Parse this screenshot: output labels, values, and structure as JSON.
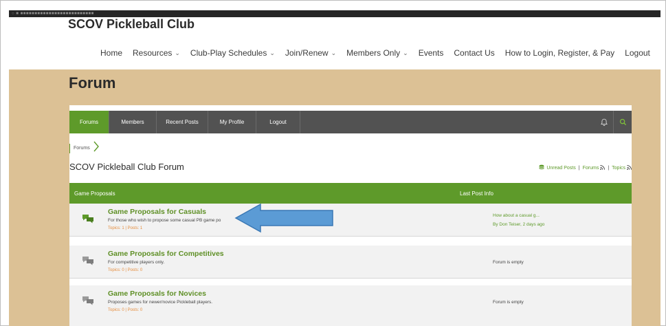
{
  "site": {
    "title": "SCOV Pickleball Club"
  },
  "nav": [
    {
      "label": "Home",
      "caret": false
    },
    {
      "label": "Resources",
      "caret": true
    },
    {
      "label": "Club-Play Schedules",
      "caret": true
    },
    {
      "label": "Join/Renew",
      "caret": true
    },
    {
      "label": "Members Only",
      "caret": true
    },
    {
      "label": "Events",
      "caret": false
    },
    {
      "label": "Contact Us",
      "caret": false
    },
    {
      "label": "How to Login, Register, & Pay",
      "caret": false
    },
    {
      "label": "Logout",
      "caret": false
    }
  ],
  "page": {
    "title": "Forum"
  },
  "forum_nav": {
    "tabs": [
      "Forums",
      "Members",
      "Recent Posts",
      "My Profile",
      "Logout"
    ],
    "active": "Forums"
  },
  "breadcrumb": {
    "label": "Forums"
  },
  "forum": {
    "title": "SCOV Pickleball Club Forum",
    "unread_label": "Unread Posts",
    "forums_label": "Forums",
    "topics_label": "Topics"
  },
  "category": {
    "name": "Game Proposals",
    "last_post_header": "Last Post Info"
  },
  "forums": [
    {
      "name": "Game Proposals for Casuals",
      "description": "For those who wish to propose some casual PB game po",
      "stats": "Topics: 1  |  Posts: 1",
      "last_title": "How about a casual g...",
      "last_by": "By Don Teiser, 2 days ago",
      "unread": true
    },
    {
      "name": "Game Proposals for Competitives",
      "description": "For competitive players only.",
      "stats": "Topics: 0  |  Posts: 0",
      "last_title": "Forum is empty",
      "last_by": "",
      "unread": false
    },
    {
      "name": "Game Proposals for Novices",
      "description": "Proposes games for newer/novice Pickleball players.",
      "stats": "Topics: 0  |  Posts: 0",
      "last_title": "Forum is empty",
      "last_by": "",
      "unread": false
    }
  ],
  "colors": {
    "brand_green": "#5e9a2a",
    "tan_background": "#dcc195",
    "dark_bar": "#525252",
    "stats_orange": "#e58c3c",
    "annotation_arrow": "#5b9bd5"
  },
  "icons": {
    "bell": "bell-icon",
    "search": "search-icon",
    "breadcrumb": "chevron-right-icon",
    "rss": "rss-icon",
    "unread": "unread-stack-icon",
    "forum": "chat-bubbles-icon"
  }
}
